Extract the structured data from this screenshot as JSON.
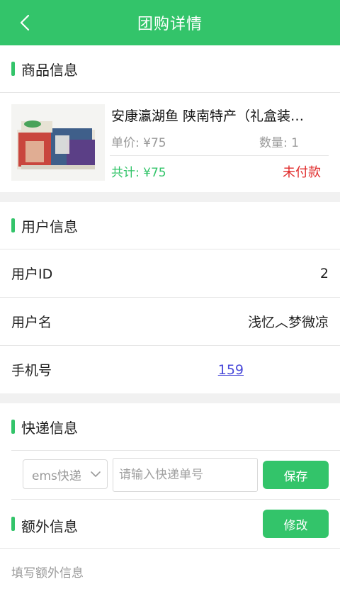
{
  "nav": {
    "title": "团购详情",
    "back_icon": "chevron-left-icon"
  },
  "product_section": {
    "title": "商品信息",
    "item": {
      "name": "安康瀛湖鱼 陕南特产（礼盒装…",
      "unit_price": "单价: ¥75",
      "quantity": "数量: 1",
      "total": "共计: ¥75",
      "status": "未付款"
    }
  },
  "user_section": {
    "title": "用户信息",
    "rows": [
      {
        "key": "用户ID",
        "value": "2"
      },
      {
        "key": "用户名",
        "value": "浅忆︿梦微凉"
      },
      {
        "key": "手机号",
        "value": "159"
      }
    ]
  },
  "express_section": {
    "title": "快递信息",
    "carrier": "ems快递",
    "tracking_placeholder": "请输入快递单号",
    "save_label": "保存"
  },
  "extra_section": {
    "title": "额外信息",
    "edit_label": "修改",
    "placeholder": "填写额外信息"
  },
  "colors": {
    "accent": "#33c46a",
    "danger": "#e02b2b",
    "link": "#4a4ad9"
  }
}
